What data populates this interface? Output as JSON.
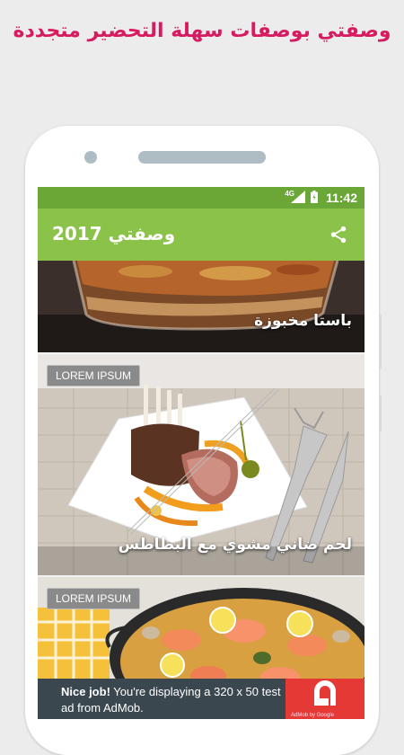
{
  "promo": {
    "headline": "وصفتي بوصفات سهلة التحضير متجددة"
  },
  "status_bar": {
    "network": "4G",
    "time": "11:42"
  },
  "app_bar": {
    "title": "وصفتي 2017"
  },
  "recipes": [
    {
      "title": "باستا مخبوزة",
      "badge": ""
    },
    {
      "title": "لحم ضاني مشوي مع البطاطس",
      "badge": "LOREM IPSUM"
    },
    {
      "title": "",
      "badge": "LOREM IPSUM"
    }
  ],
  "ad": {
    "lead": "Nice job!",
    "message": " You're displaying a 320 x 50 test ad from AdMob.",
    "brand": "AdMob by Google"
  },
  "colors": {
    "statusbar": "#6aa736",
    "appbar": "#8bc34a",
    "promo_text": "#d81b60",
    "ad_logo": "#e53935"
  },
  "icons": {
    "share": "share-icon",
    "battery": "battery-icon",
    "signal": "signal-icon"
  }
}
